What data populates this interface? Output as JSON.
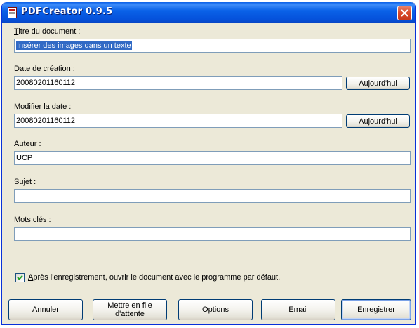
{
  "window": {
    "title": "PDFCreator 0.9.5"
  },
  "fields": {
    "titre": {
      "label_key": "T",
      "label_rest": "itre du document :",
      "value": "Insérer des images dans un texte"
    },
    "date_creation": {
      "label_key": "D",
      "label_rest": "ate de création :",
      "value": "20080201160112",
      "button": "Aujourd'hui"
    },
    "modifier_date": {
      "label_key": "M",
      "label_rest": "odifier la date :",
      "value": "20080201160112",
      "button": "Aujourd'hui"
    },
    "auteur": {
      "label_pre": "A",
      "label_key": "u",
      "label_rest": "teur :",
      "value": "UCP"
    },
    "sujet": {
      "label": "Sujet :",
      "value": ""
    },
    "mots_cles": {
      "label_pre": "M",
      "label_key": "o",
      "label_rest": "ts clés :",
      "value": ""
    }
  },
  "checkbox": {
    "checked": true,
    "label_key": "A",
    "label_rest": "près l'enregistrement, ouvrir le document avec le programme par défaut."
  },
  "buttons": {
    "annuler": {
      "key": "A",
      "rest": "nnuler"
    },
    "mettre_en_file": {
      "line1": "Mettre en file",
      "line2_pre": "d'",
      "line2_key": "a",
      "line2_rest": "ttente"
    },
    "options": "Options",
    "email": {
      "key": "E",
      "rest": "mail"
    },
    "enregistrer": {
      "pre": "Enregist",
      "key": "r",
      "rest": "er"
    }
  }
}
